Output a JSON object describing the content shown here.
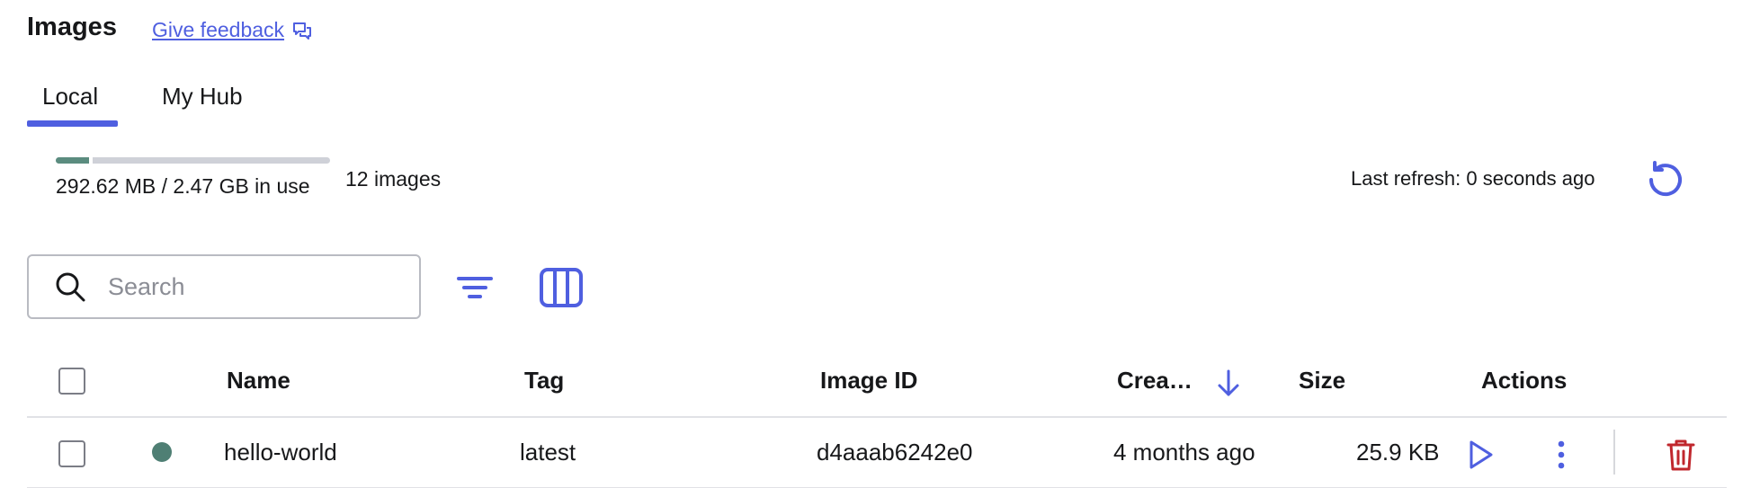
{
  "header": {
    "title": "Images",
    "feedback_link": "Give feedback"
  },
  "tabs": [
    {
      "label": "Local",
      "active": true
    },
    {
      "label": "My Hub",
      "active": false
    }
  ],
  "usage": {
    "text": "292.62 MB / 2.47 GB in use",
    "used_fraction": 0.12,
    "images_count": "12 images"
  },
  "refresh": {
    "text": "Last refresh: 0 seconds ago"
  },
  "search": {
    "placeholder": "Search",
    "value": ""
  },
  "table": {
    "columns": {
      "name": "Name",
      "tag": "Tag",
      "image_id": "Image ID",
      "created": "Crea…",
      "size": "Size",
      "actions": "Actions"
    },
    "sort": {
      "column": "created",
      "direction": "descending"
    },
    "rows": [
      {
        "status": "unused",
        "name": "hello-world",
        "tag": "latest",
        "image_id": "d4aaab6242e0",
        "created": "4 months ago",
        "size": "25.9 KB"
      }
    ]
  },
  "colors": {
    "accent": "#4f5fe0",
    "usage_green": "#5b8c7f",
    "status_dot": "#4f7f74",
    "delete_red": "#c0272d"
  },
  "icons": [
    "chat-bubbles-icon",
    "refresh-icon",
    "search-icon",
    "filter-icon",
    "columns-icon",
    "arrow-down-icon",
    "play-icon",
    "kebab-menu-icon",
    "trash-icon"
  ]
}
